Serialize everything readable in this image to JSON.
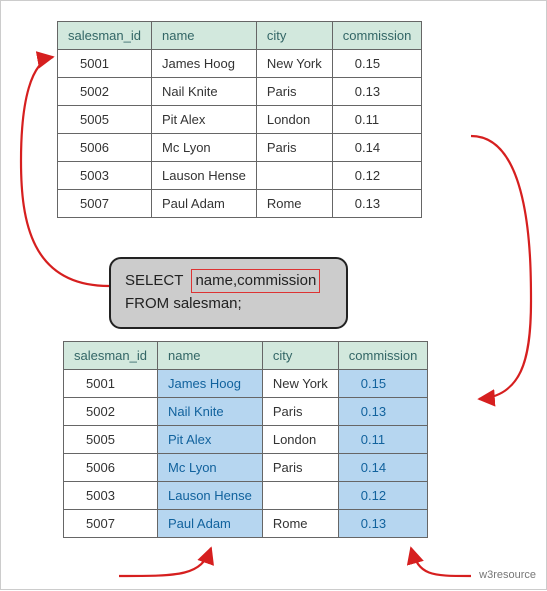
{
  "columns": [
    "salesman_id",
    "name",
    "city",
    "commission"
  ],
  "rows": [
    {
      "id": "5001",
      "name": "James Hoog",
      "city": "New York",
      "comm": "0.15"
    },
    {
      "id": "5002",
      "name": "Nail Knite",
      "city": "Paris",
      "comm": "0.13"
    },
    {
      "id": "5005",
      "name": "Pit Alex",
      "city": "London",
      "comm": "0.11"
    },
    {
      "id": "5006",
      "name": "Mc Lyon",
      "city": "Paris",
      "comm": "0.14"
    },
    {
      "id": "5003",
      "name": "Lauson Hense",
      "city": "",
      "comm": "0.12"
    },
    {
      "id": "5007",
      "name": "Paul Adam",
      "city": "Rome",
      "comm": "0.13"
    }
  ],
  "sql": {
    "select_kw": "SELECT",
    "projection": "name,commission",
    "from_line": "FROM salesman;"
  },
  "watermark": "w3resource"
}
